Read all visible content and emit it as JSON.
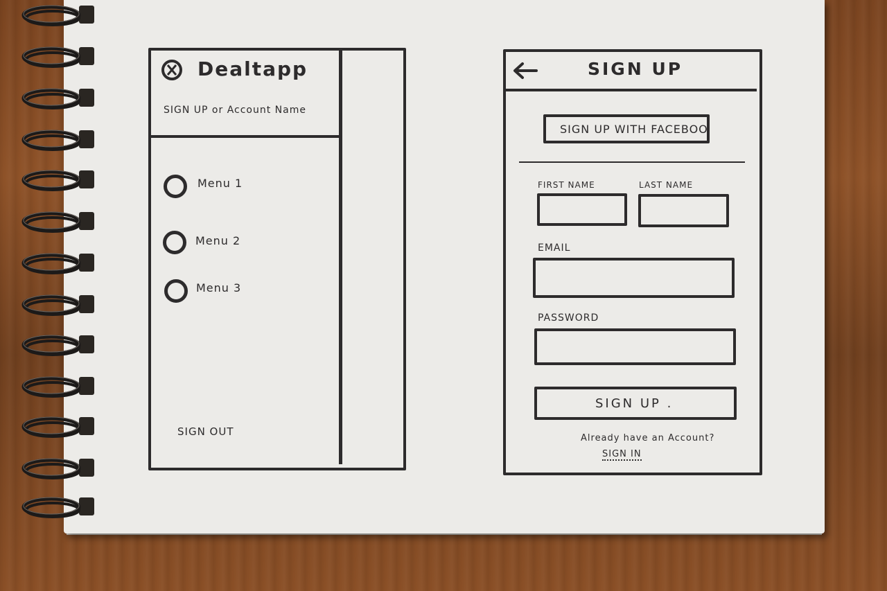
{
  "drawer": {
    "logo_icon": "close-circle-icon",
    "app_name": "Dealtapp",
    "account_line": "SIGN UP  or  Account Name",
    "menu_items": [
      {
        "label": "Menu 1"
      },
      {
        "label": "Menu 2"
      },
      {
        "label": "Menu 3"
      }
    ],
    "sign_out": "SIGN OUT"
  },
  "signup": {
    "back_icon": "arrow-left-icon",
    "title": "SIGN UP",
    "facebook_button": "SIGN UP WITH FACEBOOK",
    "first_name_label": "FIRST NAME",
    "last_name_label": "LAST NAME",
    "email_label": "EMAIL",
    "password_label": "PASSWORD",
    "submit_button": "SIGN UP .",
    "already_text": "Already have an Account?",
    "sign_in_link": "SIGN IN"
  },
  "colors": {
    "ink": "#2d2b2c",
    "paper": "#ecebe8",
    "wood": "#7a4420"
  }
}
